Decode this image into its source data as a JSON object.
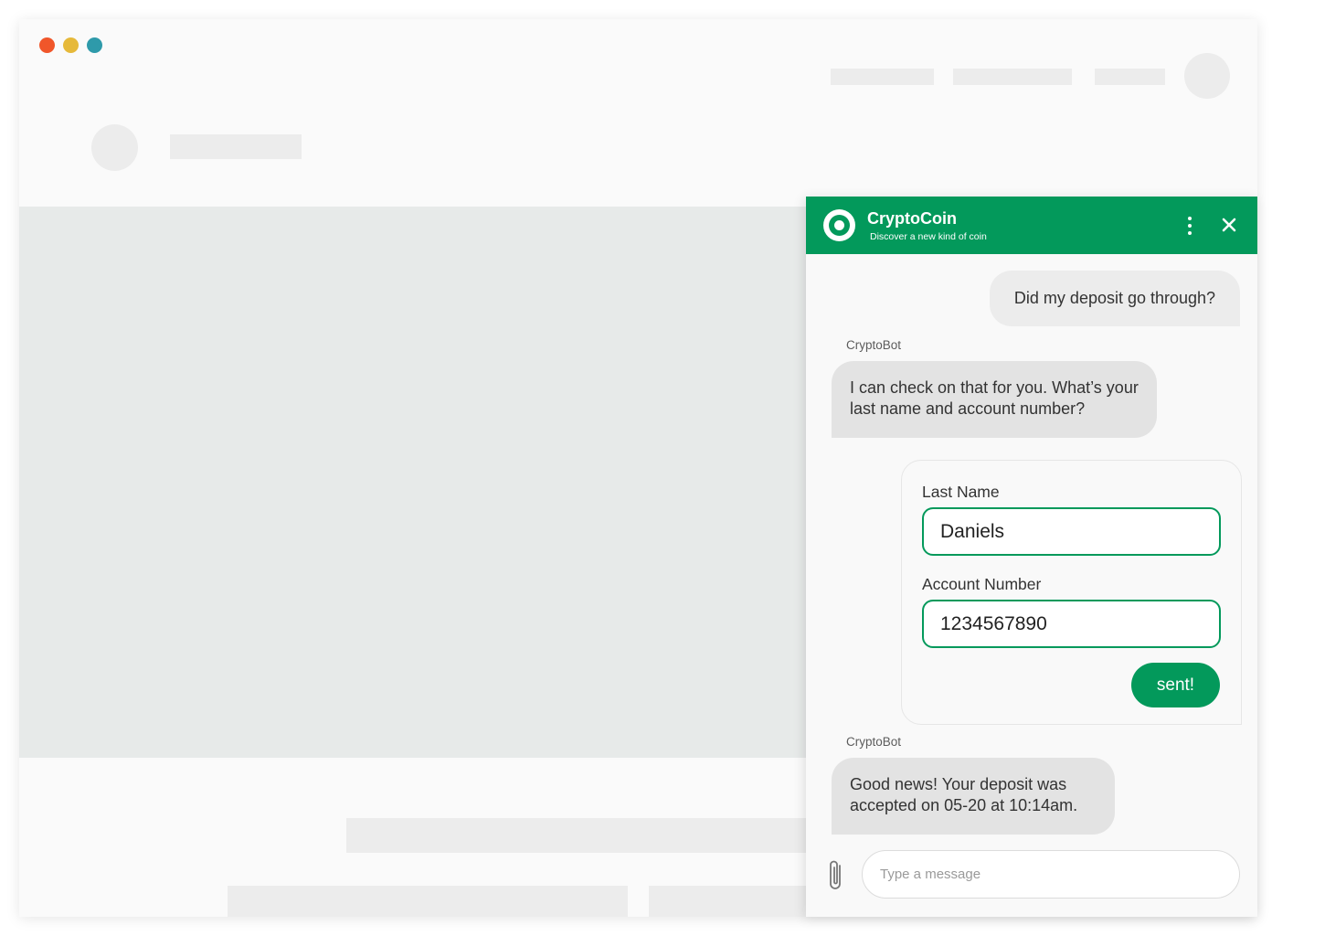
{
  "window": {
    "traffic_lights": [
      "#f0562a",
      "#e6b93a",
      "#2e9aaa"
    ]
  },
  "chat": {
    "brand": {
      "name": "CryptoCoin",
      "tagline": "Discover a new kind of coin",
      "accent": "#03995b"
    },
    "header_icons": [
      "kebab-menu-icon",
      "close-icon"
    ],
    "messages": [
      {
        "from": "user",
        "text": "Did my deposit go through?"
      },
      {
        "from": "bot",
        "sender": "CryptoBot",
        "text": "I can check on that for you. What’s your last name and account number?"
      },
      {
        "from": "bot",
        "sender": "CryptoBot",
        "text": "Good news! Your deposit was accepted on 05-20 at 10:14am."
      }
    ],
    "form": {
      "last_name_label": "Last Name",
      "last_name_value": "Daniels",
      "account_label": "Account Number",
      "account_value": "1234567890",
      "submit_label": "sent!"
    },
    "composer": {
      "placeholder": "Type a message",
      "attach_icon": "paperclip-icon"
    }
  }
}
